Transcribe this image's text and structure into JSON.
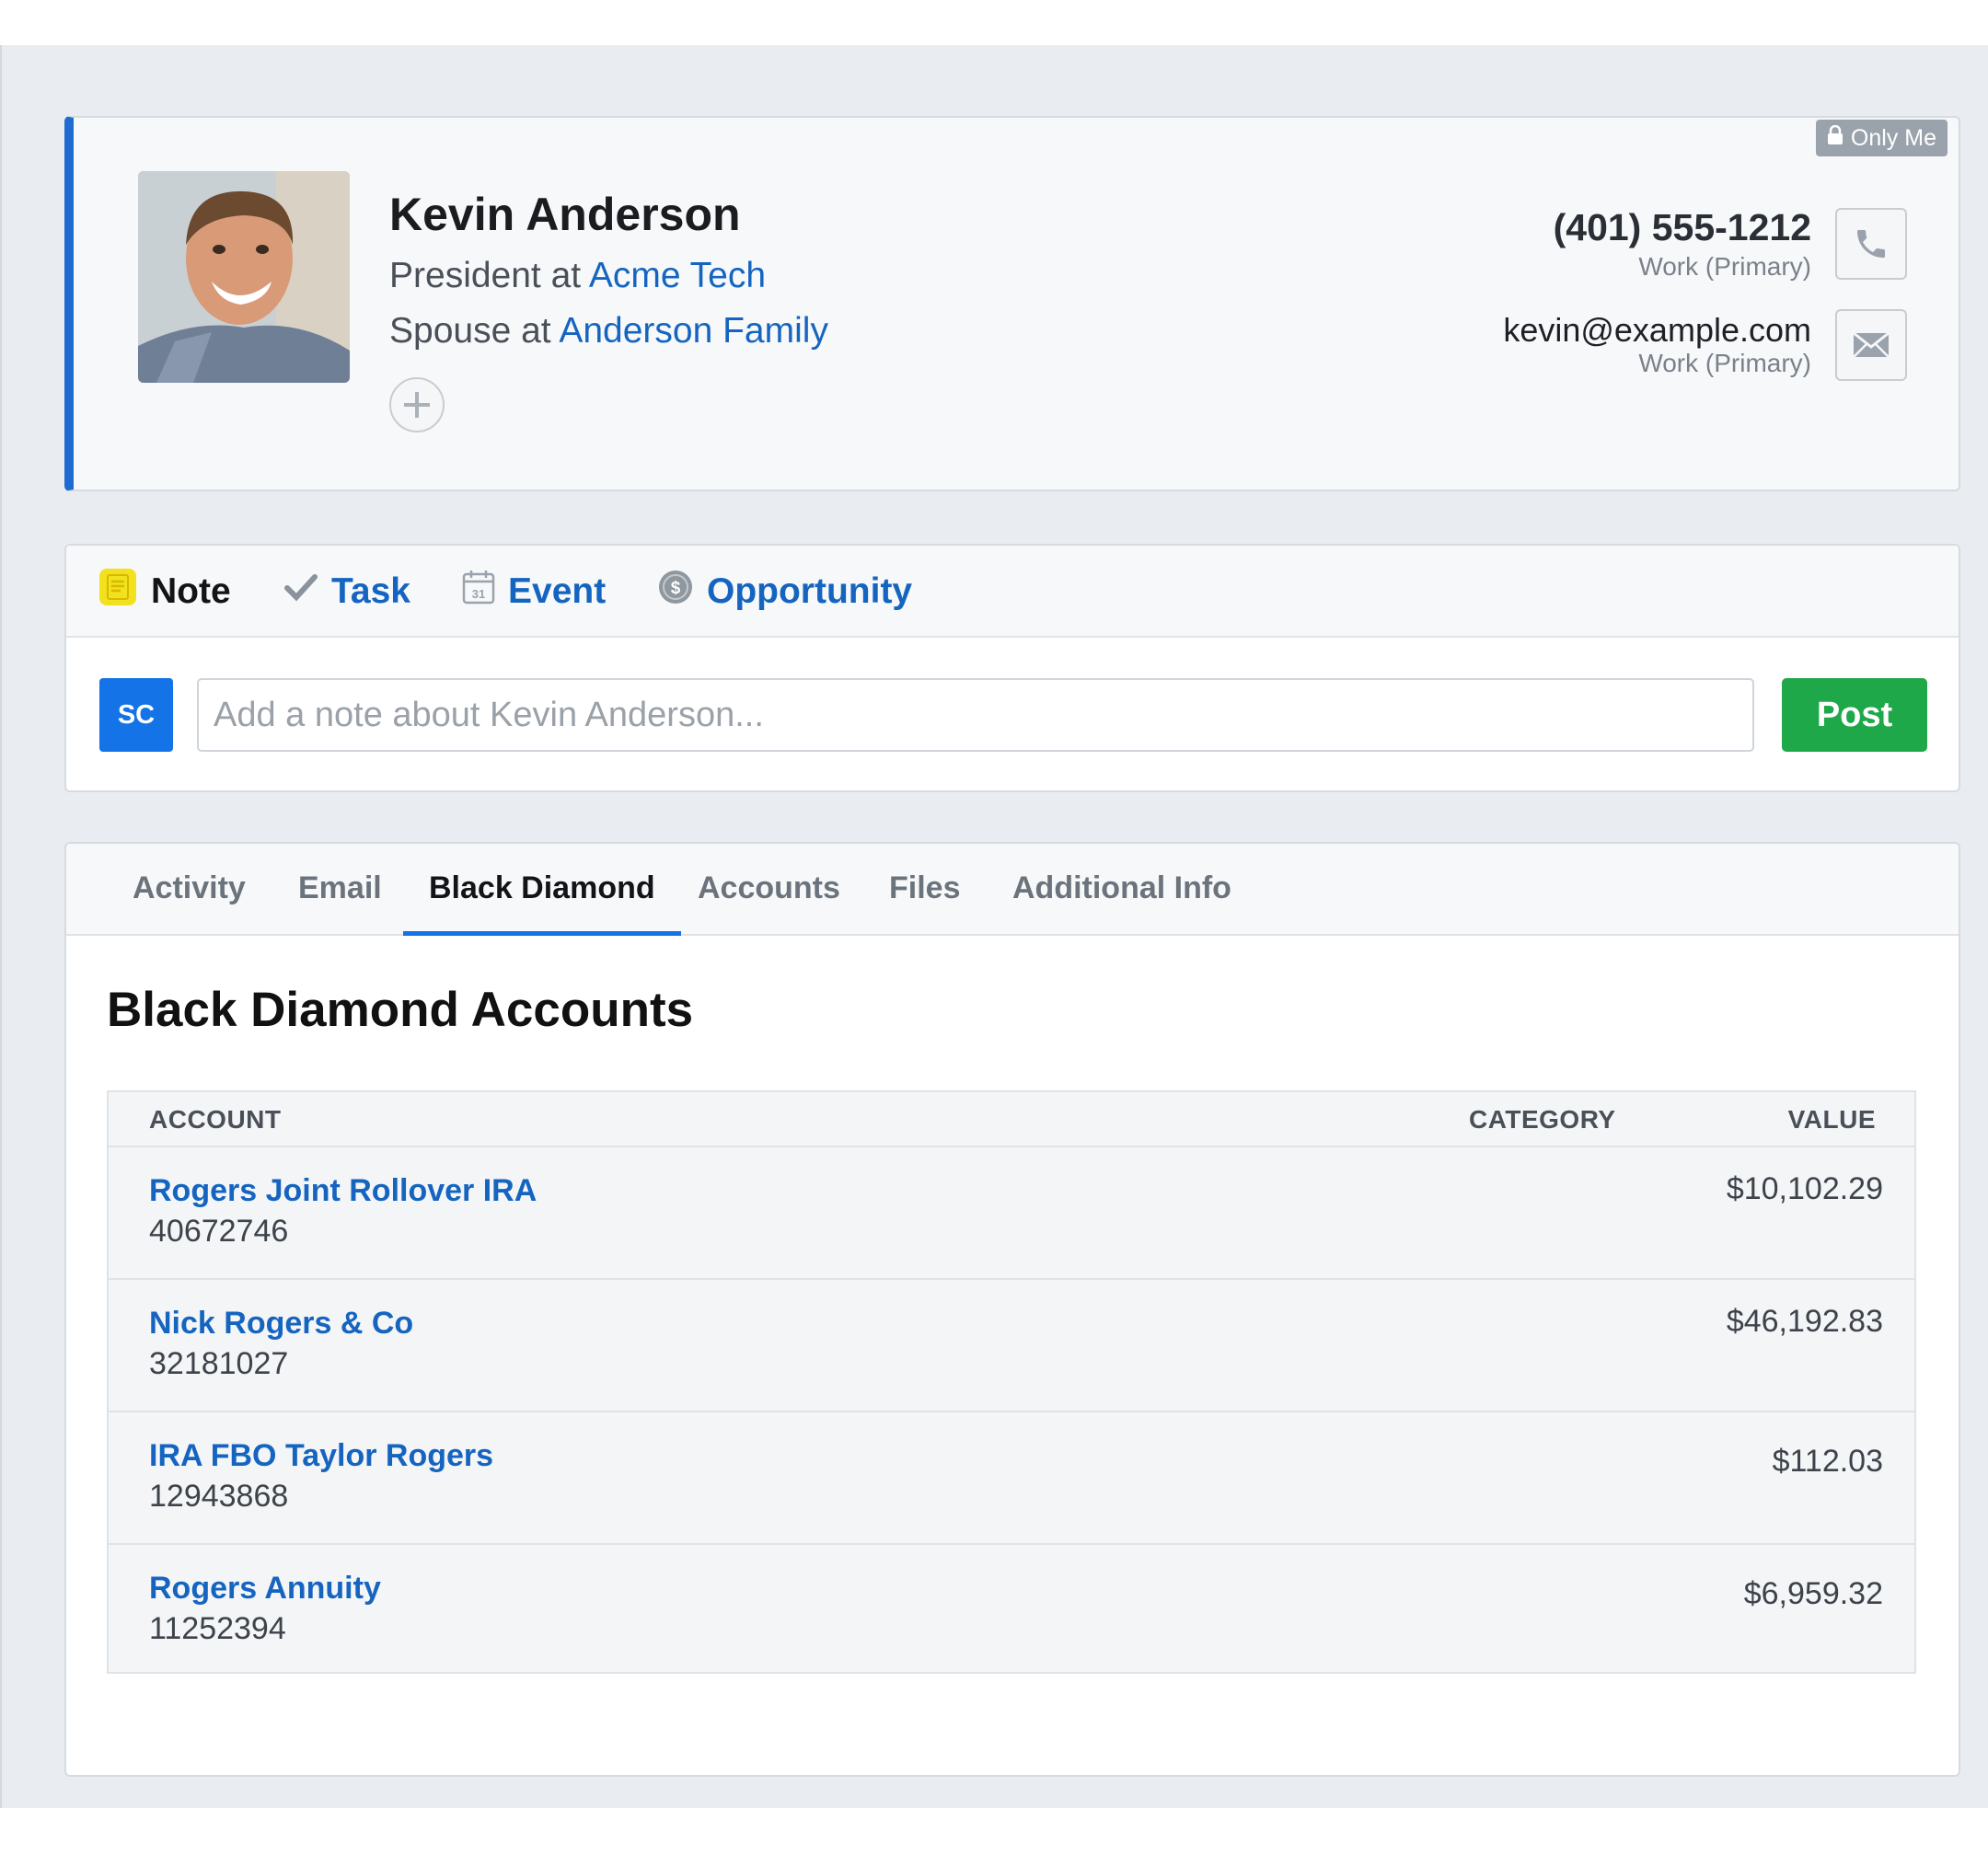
{
  "contact": {
    "privacy_badge": "Only Me",
    "name": "Kevin Anderson",
    "roles": [
      {
        "prefix": "President at ",
        "org": "Acme Tech"
      },
      {
        "prefix": "Spouse at ",
        "org": "Anderson Family"
      }
    ],
    "phone": {
      "value": "(401) 555-1212",
      "label": "Work (Primary)"
    },
    "email": {
      "value": "kevin@example.com",
      "label": "Work (Primary)"
    }
  },
  "composer": {
    "tabs": [
      {
        "label": "Note",
        "icon": "note-icon"
      },
      {
        "label": "Task",
        "icon": "check-icon"
      },
      {
        "label": "Event",
        "icon": "calendar-icon"
      },
      {
        "label": "Opportunity",
        "icon": "dollar-icon"
      }
    ],
    "user_initials": "SC",
    "placeholder": "Add a note about Kevin Anderson...",
    "post_label": "Post",
    "accent": "#1fa84a"
  },
  "detail": {
    "tabs": [
      "Activity",
      "Email",
      "Black Diamond",
      "Accounts",
      "Files",
      "Additional Info"
    ],
    "active_tab": "Black Diamond",
    "heading": "Black Diamond Accounts",
    "columns": {
      "account": "ACCOUNT",
      "category": "CATEGORY",
      "value": "VALUE"
    },
    "rows": [
      {
        "name": "Rogers Joint Rollover IRA",
        "number": "40672746",
        "category": "",
        "value": "$10,102.29"
      },
      {
        "name": "Nick Rogers & Co",
        "number": "32181027",
        "category": "",
        "value": "$46,192.83"
      },
      {
        "name": "IRA FBO Taylor Rogers",
        "number": "12943868",
        "category": "",
        "value": "$112.03"
      },
      {
        "name": "Rogers Annuity",
        "number": "11252394",
        "category": "",
        "value": "$6,959.32"
      }
    ]
  },
  "colors": {
    "brand_blue": "#1473e6",
    "link": "#1565c0",
    "accent_bar": "#1f6bd0"
  }
}
